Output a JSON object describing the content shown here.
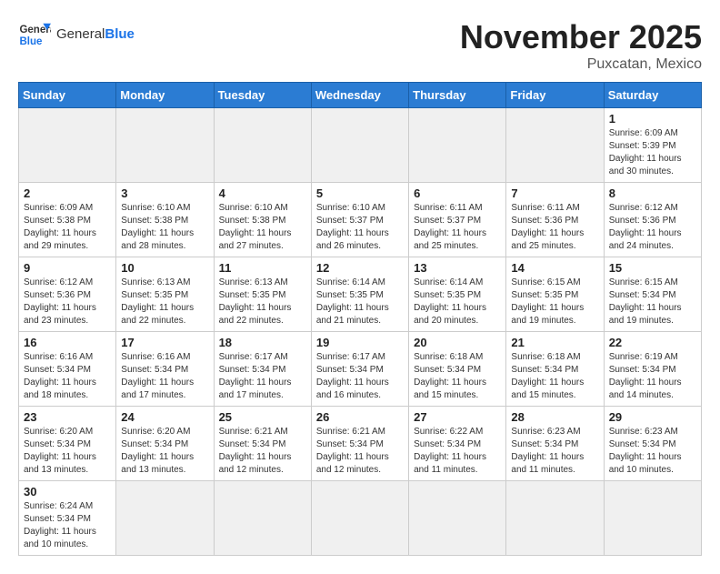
{
  "header": {
    "logo_general": "General",
    "logo_blue": "Blue",
    "month": "November 2025",
    "location": "Puxcatan, Mexico"
  },
  "weekdays": [
    "Sunday",
    "Monday",
    "Tuesday",
    "Wednesday",
    "Thursday",
    "Friday",
    "Saturday"
  ],
  "weeks": [
    [
      {
        "day": "",
        "empty": true
      },
      {
        "day": "",
        "empty": true
      },
      {
        "day": "",
        "empty": true
      },
      {
        "day": "",
        "empty": true
      },
      {
        "day": "",
        "empty": true
      },
      {
        "day": "",
        "empty": true
      },
      {
        "day": "1",
        "sunrise": "6:09 AM",
        "sunset": "5:39 PM",
        "daylight": "11 hours and 30 minutes."
      }
    ],
    [
      {
        "day": "2",
        "sunrise": "6:09 AM",
        "sunset": "5:38 PM",
        "daylight": "11 hours and 29 minutes."
      },
      {
        "day": "3",
        "sunrise": "6:10 AM",
        "sunset": "5:38 PM",
        "daylight": "11 hours and 28 minutes."
      },
      {
        "day": "4",
        "sunrise": "6:10 AM",
        "sunset": "5:38 PM",
        "daylight": "11 hours and 27 minutes."
      },
      {
        "day": "5",
        "sunrise": "6:10 AM",
        "sunset": "5:37 PM",
        "daylight": "11 hours and 26 minutes."
      },
      {
        "day": "6",
        "sunrise": "6:11 AM",
        "sunset": "5:37 PM",
        "daylight": "11 hours and 25 minutes."
      },
      {
        "day": "7",
        "sunrise": "6:11 AM",
        "sunset": "5:36 PM",
        "daylight": "11 hours and 25 minutes."
      },
      {
        "day": "8",
        "sunrise": "6:12 AM",
        "sunset": "5:36 PM",
        "daylight": "11 hours and 24 minutes."
      }
    ],
    [
      {
        "day": "9",
        "sunrise": "6:12 AM",
        "sunset": "5:36 PM",
        "daylight": "11 hours and 23 minutes."
      },
      {
        "day": "10",
        "sunrise": "6:13 AM",
        "sunset": "5:35 PM",
        "daylight": "11 hours and 22 minutes."
      },
      {
        "day": "11",
        "sunrise": "6:13 AM",
        "sunset": "5:35 PM",
        "daylight": "11 hours and 22 minutes."
      },
      {
        "day": "12",
        "sunrise": "6:14 AM",
        "sunset": "5:35 PM",
        "daylight": "11 hours and 21 minutes."
      },
      {
        "day": "13",
        "sunrise": "6:14 AM",
        "sunset": "5:35 PM",
        "daylight": "11 hours and 20 minutes."
      },
      {
        "day": "14",
        "sunrise": "6:15 AM",
        "sunset": "5:35 PM",
        "daylight": "11 hours and 19 minutes."
      },
      {
        "day": "15",
        "sunrise": "6:15 AM",
        "sunset": "5:34 PM",
        "daylight": "11 hours and 19 minutes."
      }
    ],
    [
      {
        "day": "16",
        "sunrise": "6:16 AM",
        "sunset": "5:34 PM",
        "daylight": "11 hours and 18 minutes."
      },
      {
        "day": "17",
        "sunrise": "6:16 AM",
        "sunset": "5:34 PM",
        "daylight": "11 hours and 17 minutes."
      },
      {
        "day": "18",
        "sunrise": "6:17 AM",
        "sunset": "5:34 PM",
        "daylight": "11 hours and 17 minutes."
      },
      {
        "day": "19",
        "sunrise": "6:17 AM",
        "sunset": "5:34 PM",
        "daylight": "11 hours and 16 minutes."
      },
      {
        "day": "20",
        "sunrise": "6:18 AM",
        "sunset": "5:34 PM",
        "daylight": "11 hours and 15 minutes."
      },
      {
        "day": "21",
        "sunrise": "6:18 AM",
        "sunset": "5:34 PM",
        "daylight": "11 hours and 15 minutes."
      },
      {
        "day": "22",
        "sunrise": "6:19 AM",
        "sunset": "5:34 PM",
        "daylight": "11 hours and 14 minutes."
      }
    ],
    [
      {
        "day": "23",
        "sunrise": "6:20 AM",
        "sunset": "5:34 PM",
        "daylight": "11 hours and 13 minutes."
      },
      {
        "day": "24",
        "sunrise": "6:20 AM",
        "sunset": "5:34 PM",
        "daylight": "11 hours and 13 minutes."
      },
      {
        "day": "25",
        "sunrise": "6:21 AM",
        "sunset": "5:34 PM",
        "daylight": "11 hours and 12 minutes."
      },
      {
        "day": "26",
        "sunrise": "6:21 AM",
        "sunset": "5:34 PM",
        "daylight": "11 hours and 12 minutes."
      },
      {
        "day": "27",
        "sunrise": "6:22 AM",
        "sunset": "5:34 PM",
        "daylight": "11 hours and 11 minutes."
      },
      {
        "day": "28",
        "sunrise": "6:23 AM",
        "sunset": "5:34 PM",
        "daylight": "11 hours and 11 minutes."
      },
      {
        "day": "29",
        "sunrise": "6:23 AM",
        "sunset": "5:34 PM",
        "daylight": "11 hours and 10 minutes."
      }
    ],
    [
      {
        "day": "30",
        "sunrise": "6:24 AM",
        "sunset": "5:34 PM",
        "daylight": "11 hours and 10 minutes."
      },
      {
        "day": "",
        "empty": true
      },
      {
        "day": "",
        "empty": true
      },
      {
        "day": "",
        "empty": true
      },
      {
        "day": "",
        "empty": true
      },
      {
        "day": "",
        "empty": true
      },
      {
        "day": "",
        "empty": true
      }
    ]
  ]
}
